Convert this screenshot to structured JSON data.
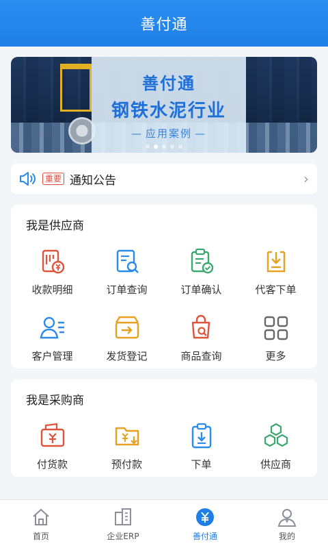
{
  "header": {
    "title": "善付通"
  },
  "banner": {
    "line1": "善付通",
    "line2": "钢铁水泥行业",
    "line3": "应用案例",
    "dot_count": 5,
    "active_dot": 1
  },
  "notice": {
    "badge": "重要",
    "label": "通知公告"
  },
  "supplier": {
    "title": "我是供应商",
    "items": [
      {
        "label": "收款明细",
        "icon": "receipt-yuan-icon",
        "color": "#e0533a"
      },
      {
        "label": "订单查询",
        "icon": "order-search-icon",
        "color": "#2a8be8"
      },
      {
        "label": "订单确认",
        "icon": "order-confirm-icon",
        "color": "#3aa86e"
      },
      {
        "label": "代客下单",
        "icon": "download-order-icon",
        "color": "#e8a020"
      },
      {
        "label": "客户管理",
        "icon": "customer-icon",
        "color": "#2a8be8"
      },
      {
        "label": "发货登记",
        "icon": "shipment-box-icon",
        "color": "#e8a020"
      },
      {
        "label": "商品查询",
        "icon": "bag-search-icon",
        "color": "#e0533a"
      },
      {
        "label": "更多",
        "icon": "grid-more-icon",
        "color": "#666666"
      }
    ]
  },
  "buyer": {
    "title": "我是采购商",
    "items": [
      {
        "label": "付货款",
        "icon": "pay-yuan-icon",
        "color": "#e0533a"
      },
      {
        "label": "预付款",
        "icon": "prepay-folder-icon",
        "color": "#e8a020"
      },
      {
        "label": "下单",
        "icon": "clipboard-order-icon",
        "color": "#2a8be8"
      },
      {
        "label": "供应商",
        "icon": "hexagon-supplier-icon",
        "color": "#3aa86e"
      }
    ]
  },
  "tabs": [
    {
      "label": "首页",
      "icon": "home-icon"
    },
    {
      "label": "企业ERP",
      "icon": "buildings-icon"
    },
    {
      "label": "善付通",
      "icon": "yuan-coin-icon",
      "active": true
    },
    {
      "label": "我的",
      "icon": "user-icon"
    }
  ]
}
